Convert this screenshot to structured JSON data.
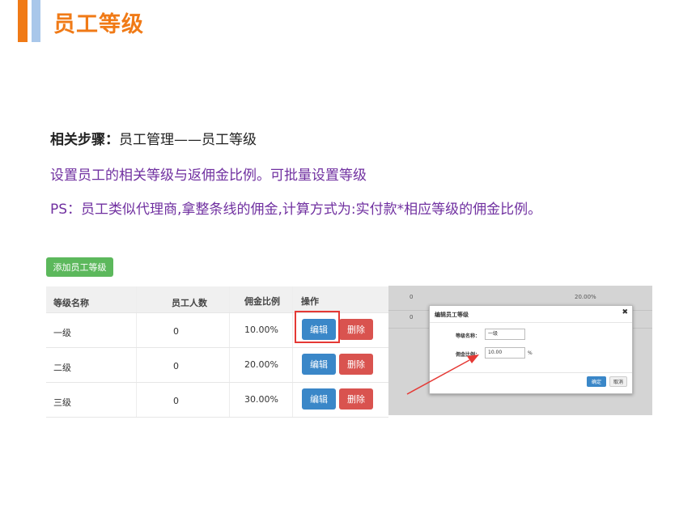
{
  "header": {
    "title": "员工等级"
  },
  "text": {
    "steps_label": "相关步骤：",
    "steps_value": "员工管理——员工等级",
    "desc": "设置员工的相关等级与返佣金比例。可批量设置等级",
    "ps": "PS：员工类似代理商,拿整条线的佣金,计算方式为:实付款*相应等级的佣金比例。"
  },
  "toolbar": {
    "add_label": "添加员工等级"
  },
  "table": {
    "headers": [
      "等级名称",
      "员工人数",
      "佣金比例",
      "操作"
    ],
    "rows": [
      {
        "name": "一级",
        "count": "0",
        "ratio": "10.00%"
      },
      {
        "name": "二级",
        "count": "0",
        "ratio": "20.00%"
      },
      {
        "name": "三级",
        "count": "0",
        "ratio": "30.00%"
      }
    ],
    "edit_label": "编辑",
    "delete_label": "删除"
  },
  "background_rows": [
    {
      "left": "0",
      "right": "20.00%"
    },
    {
      "left": "0",
      "right": ""
    }
  ],
  "dialog": {
    "title": "编辑员工等级",
    "close": "✖",
    "name_label": "等级名称：",
    "name_value": "一级",
    "ratio_label": "佣金比例：",
    "ratio_value": "10.00",
    "ratio_unit": "%",
    "confirm_label": "确定",
    "cancel_label": "取消"
  },
  "colors": {
    "accent": "#f07a16",
    "purple_text": "#7030a0",
    "highlight": "#e53935"
  }
}
